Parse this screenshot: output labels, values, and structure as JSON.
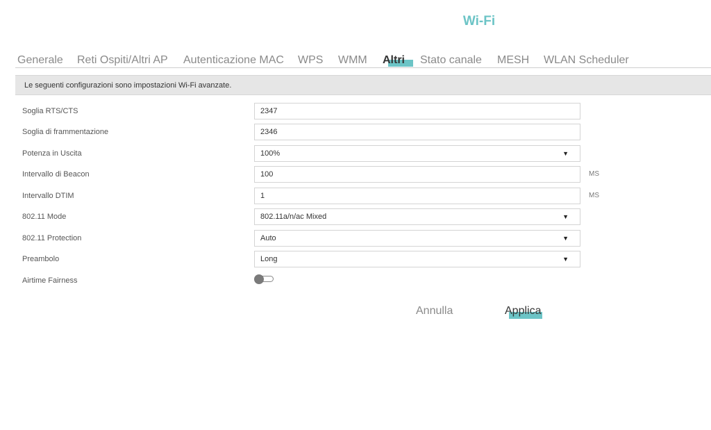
{
  "header": {
    "title": "Wi-Fi"
  },
  "tabs": [
    {
      "label": "Generale"
    },
    {
      "label": "Reti Ospiti/Altri AP"
    },
    {
      "label": "Autenticazione MAC"
    },
    {
      "label": "WPS"
    },
    {
      "label": "WMM"
    },
    {
      "label": "Altri",
      "active": true
    },
    {
      "label": "Stato canale"
    },
    {
      "label": "MESH"
    },
    {
      "label": "WLAN Scheduler"
    }
  ],
  "info": "Le seguenti configurazioni sono impostazioni Wi-Fi avanzate.",
  "fields": {
    "rts": {
      "label": "Soglia RTS/CTS",
      "value": "2347"
    },
    "frag": {
      "label": "Soglia di frammentazione",
      "value": "2346"
    },
    "power": {
      "label": "Potenza in Uscita",
      "value": "100%"
    },
    "beacon": {
      "label": "Intervallo di Beacon",
      "value": "100",
      "unit": "MS"
    },
    "dtim": {
      "label": "Intervallo DTIM",
      "value": "1",
      "unit": "MS"
    },
    "mode": {
      "label": "802.11 Mode",
      "value": "802.11a/n/ac Mixed"
    },
    "protection": {
      "label": "802.11 Protection",
      "value": "Auto"
    },
    "preamble": {
      "label": "Preambolo",
      "value": "Long"
    },
    "airtime": {
      "label": "Airtime Fairness",
      "enabled": false
    }
  },
  "buttons": {
    "cancel": "Annulla",
    "apply": "Applica"
  }
}
